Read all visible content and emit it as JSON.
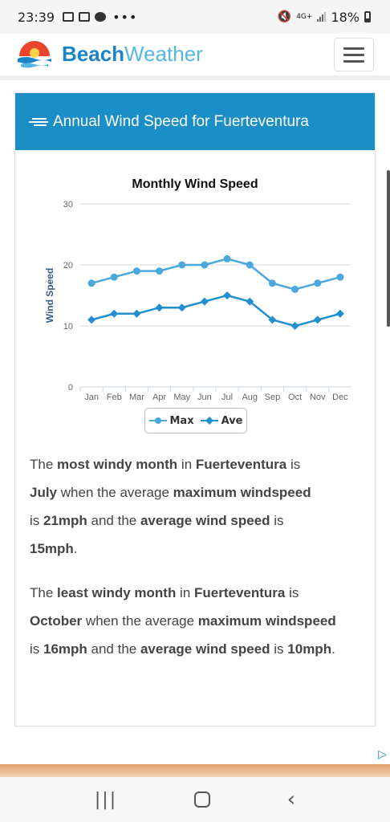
{
  "status_bar": {
    "time": "23:39",
    "dots": "•••",
    "network_label": "4G+",
    "battery": "18%"
  },
  "header": {
    "brand_part1": "Beach",
    "brand_part2": "Weather"
  },
  "card": {
    "title": "Annual Wind Speed for Fuerteventura"
  },
  "chart_data": {
    "type": "line",
    "title": "Monthly Wind Speed",
    "ylabel": "Wind Speed",
    "xlabel": "",
    "categories": [
      "Jan",
      "Feb",
      "Mar",
      "Apr",
      "May",
      "Jun",
      "Jul",
      "Aug",
      "Sep",
      "Oct",
      "Nov",
      "Dec"
    ],
    "ylim": [
      0,
      30
    ],
    "yticks": [
      0,
      10,
      20,
      30
    ],
    "grid": true,
    "legend_position": "bottom",
    "series": [
      {
        "name": "Max",
        "values": [
          17,
          18,
          19,
          19,
          20,
          20,
          21,
          20,
          17,
          16,
          17,
          18
        ],
        "color": "#4aa8dc",
        "marker": "circle"
      },
      {
        "name": "Ave",
        "values": [
          11,
          12,
          12,
          13,
          13,
          14,
          15,
          14,
          11,
          10,
          11,
          12
        ],
        "color": "#1f8fcf",
        "marker": "diamond"
      }
    ]
  },
  "paragraph1": {
    "t1": "The ",
    "b1": "most windy month",
    "t2": " in ",
    "b2": "Fuerteventura",
    "t3": " is ",
    "b3": "July",
    "t4": " when the average ",
    "b4": "maximum windspeed",
    "t5": " is ",
    "b5": "21mph",
    "t6": " and the ",
    "b6": "average wind speed",
    "t7": " is ",
    "b7": "15mph",
    "t8": "."
  },
  "paragraph2": {
    "t1": "The ",
    "b1": "least windy month",
    "t2": " in ",
    "b2": "Fuerteventura",
    "t3": " is ",
    "b3": "October",
    "t4": " when the average ",
    "b4": "maximum windspeed",
    "t5": " is ",
    "b5": "16mph",
    "t6": " and the ",
    "b6": "average wind speed",
    "t7": " is ",
    "b7": "10mph",
    "t8": "."
  },
  "icons": {
    "logo": "sun-logo-icon",
    "menu": "hamburger-menu-icon",
    "wind": "wind-icon",
    "ad": "ad-choices-icon"
  },
  "colors": {
    "accent": "#1b8ec5",
    "brand_dark": "#1b84c7",
    "brand_light": "#55b6df"
  }
}
